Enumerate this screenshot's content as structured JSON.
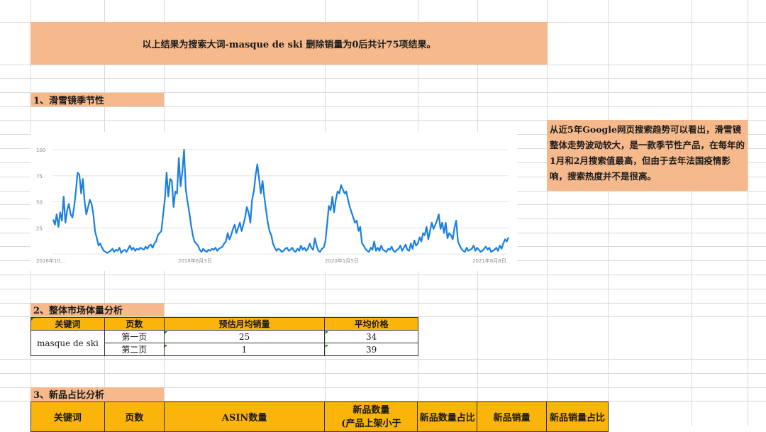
{
  "banner": "以上结果为搜索大词-masque de ski 删除销量为0后共计75项结果。",
  "section1": "1、滑雪镜季节性",
  "section2": "2、整体市场体量分析",
  "section3": "3、新品占比分析",
  "note": "从近5年Google网页搜索趋势可以看出，滑雪镜整体走势波动较大，是一款季节性产品，在每年的1月和2月搜索值最高，但由于去年法国疫情影响，搜索热度并不是很高。",
  "table1": {
    "headers": [
      "关键词",
      "页数",
      "预估月均销量",
      "平均价格"
    ],
    "keyword": "masque de ski",
    "rows": [
      {
        "page": "第一页",
        "sales": "25",
        "price": "34"
      },
      {
        "page": "第二页",
        "sales": "1",
        "price": "39"
      }
    ]
  },
  "table2": {
    "headers": [
      "关键词",
      "页数",
      "ASIN数量",
      "新品数量\n(产品上架小于",
      "新品数量占比",
      "新品销量",
      "新品销量占比"
    ]
  },
  "chart_data": {
    "type": "line",
    "title": "",
    "xlabel": "",
    "ylabel": "",
    "ylim": [
      0,
      100
    ],
    "yticks": [
      "0",
      "25",
      "50",
      "75",
      "100"
    ],
    "xtick_labels": [
      "2016年10...",
      "2018年6月3日",
      "2020年1月5日",
      "2021年8月8日"
    ],
    "series": [
      {
        "name": "",
        "color": "#1a7fe0",
        "values": [
          33,
          28,
          38,
          26,
          40,
          32,
          55,
          30,
          42,
          48,
          38,
          35,
          45,
          60,
          78,
          76,
          58,
          72,
          50,
          38,
          45,
          52,
          48,
          38,
          22,
          15,
          8,
          10,
          6,
          3,
          2,
          1,
          2,
          3,
          5,
          2,
          4,
          3,
          6,
          1,
          3,
          4,
          2,
          5,
          8,
          4,
          6,
          3,
          5,
          4,
          6,
          5,
          4,
          7,
          5,
          8,
          9,
          6,
          10,
          12,
          18,
          20,
          22,
          38,
          52,
          78,
          55,
          72,
          70,
          45,
          60,
          58,
          92,
          65,
          78,
          100,
          62,
          50,
          40,
          28,
          18,
          12,
          10,
          8,
          4,
          2,
          5,
          3,
          2,
          4,
          3,
          5,
          4,
          6,
          3,
          5,
          6,
          7,
          10,
          12,
          20,
          14,
          18,
          24,
          28,
          20,
          25,
          30,
          22,
          28,
          35,
          45,
          40,
          30,
          52,
          60,
          75,
          86,
          72,
          58,
          70,
          55,
          42,
          30,
          22,
          18,
          10,
          6,
          3,
          5,
          4,
          2,
          3,
          5,
          6,
          3,
          4,
          6,
          3,
          2,
          5,
          3,
          8,
          4,
          6,
          3,
          5,
          10,
          6,
          4,
          15,
          8,
          3,
          2,
          5,
          6,
          12,
          28,
          46,
          42,
          55,
          40,
          52,
          60,
          58,
          66,
          62,
          58,
          60,
          52,
          45,
          40,
          35,
          30,
          32,
          22,
          26,
          10,
          8,
          5,
          3,
          2,
          6,
          4,
          12,
          3,
          6,
          3,
          8,
          4,
          3,
          2,
          5,
          4,
          7,
          3,
          2,
          4,
          5,
          8,
          3,
          6,
          9,
          4,
          3,
          10,
          5,
          13,
          8,
          10,
          16,
          12,
          20,
          18,
          26,
          14,
          22,
          30,
          24,
          28,
          32,
          38,
          24,
          30,
          20,
          30,
          15,
          20,
          18,
          14,
          25,
          32,
          12,
          8,
          5,
          3,
          2,
          6,
          3,
          4,
          5,
          8,
          3,
          6,
          4,
          2,
          3,
          5,
          7,
          4,
          6,
          2,
          3,
          4,
          6,
          3,
          8,
          5,
          10,
          14,
          12,
          16
        ]
      }
    ]
  }
}
